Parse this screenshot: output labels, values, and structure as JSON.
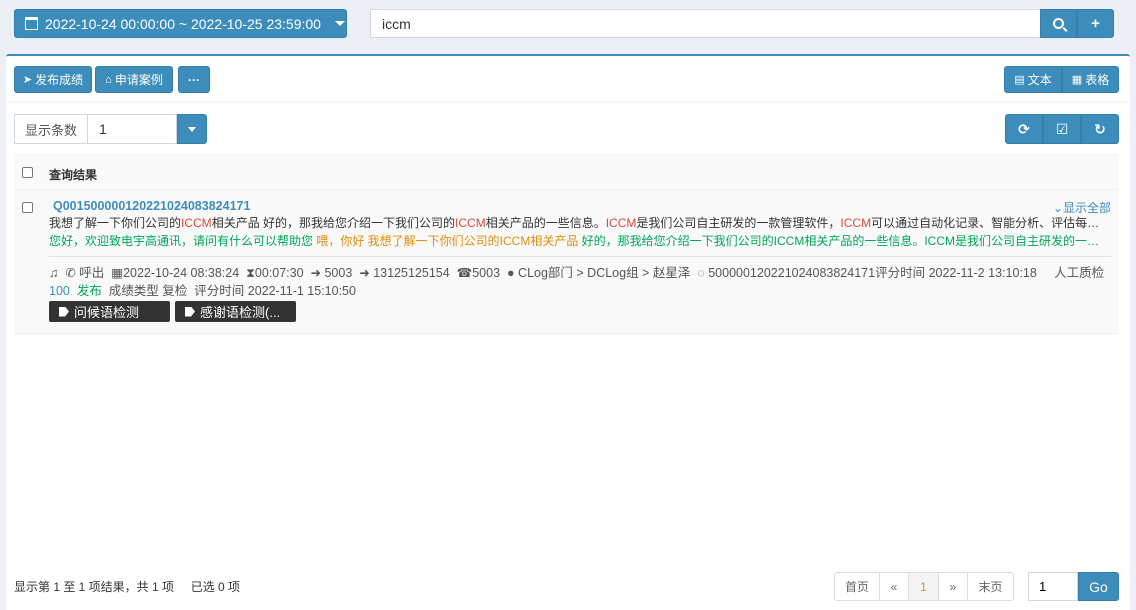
{
  "topbar": {
    "date_range": "2022-10-24 00:00:00 ~ 2022-10-25 23:59:00",
    "search_value": "iccm"
  },
  "toolbar": {
    "publish_label": "发布成绩",
    "apply_label": "申请案例",
    "more_label": "···",
    "text_label": "文本",
    "table_label": "表格"
  },
  "page_size": {
    "label": "显示条数",
    "value": "1"
  },
  "grid": {
    "header": "查询结果",
    "rows": [
      {
        "id": "Q001500000120221024083824171",
        "show_all": "显示全部",
        "line1_a": "我想了解一下你们公司的",
        "line1_b": "ICCM",
        "line1_c": "相关产品 好的，那我给您介绍一下我们公司的",
        "line1_d": "ICCM",
        "line1_e": "相关产品的一些信息。",
        "line1_f": "ICCM",
        "line1_g": "是我们公司自主研发的一款管理软件，",
        "line1_h": "ICCM",
        "line1_i": "可以通过自动化记录、智能分析、评估每一次...",
        "line2_a": "您好，欢迎致电宇高通讯，请问有什么可以帮助您 ",
        "line2_b": "喂，你好 我想了解一下你们公司的ICCM相关产品",
        "line2_c": " 好的，那我给您介绍一下我们公司的ICCM相关产品的一些信息。ICCM是我们公司自主研发的一款管...",
        "direction": "呼出",
        "call_time": "2022-10-24 08:38:24",
        "duration": "00:07:30",
        "ext": "5003",
        "caller": "13125125154",
        "callee": "5003",
        "org": "CLog部门 > DCLog组 > 赵星泽",
        "record_id": "5000001202210240838241​71",
        "score_time_label": "评分时间",
        "score_time": "2022-11-2 13:10:18",
        "qc_label": "人工质检",
        "score": "100",
        "status": "发布",
        "type_label": "成绩类型",
        "type_value": "复检",
        "score_time2_label": "评分时间",
        "score_time2": "2022-11-1 15:10:50",
        "tags": [
          "问候语检测",
          "感谢语检测(..."
        ]
      }
    ]
  },
  "footer": {
    "info": "显示第 1 至 1 项结果，共 1 项",
    "selected": "已选 0 项"
  },
  "pagination": {
    "first": "首页",
    "prev": "«",
    "current": "1",
    "next": "»",
    "last": "末页",
    "goto_value": "1",
    "go_label": "Go"
  },
  "colors": {
    "primary": "#3c8dbc",
    "highlight_red": "#dd4b39",
    "highlight_orange": "#e08e0b",
    "agent_green": "#00a65a"
  }
}
